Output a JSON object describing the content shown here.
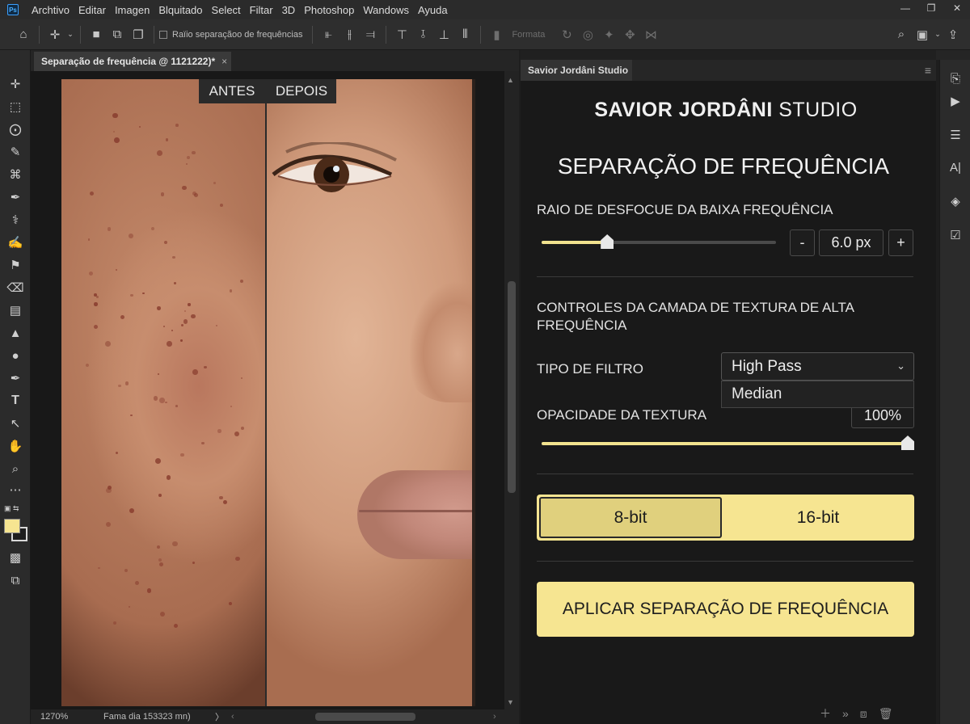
{
  "app": {
    "logo_text": "Ps",
    "menu": [
      "Archtivo",
      "Editar",
      "Imagen",
      "Blquitado",
      "Select",
      "Filtar",
      "3D",
      "Photoshop",
      "Wandows",
      "Ayuda"
    ]
  },
  "options_bar": {
    "checkbox_label": "Raïio separaçãoo de frequências",
    "format_label": "Formata"
  },
  "document": {
    "tab_title": "Separação de frequência @ 1121222)*",
    "close_glyph": "×",
    "before_label": "ANTES",
    "after_label": "DEPOIS"
  },
  "status": {
    "zoom": "1270%",
    "info": "Fama dia 153323 mn)",
    "arrow": "〉"
  },
  "panel": {
    "tab_title": "Savior Jordâni Studio",
    "brand_bold": "SAVIOR JORDÂNI",
    "brand_thin": "STUDIO",
    "title": "SEPARAÇÃO DE FREQUÊNCIA",
    "blur_label": "RAIO DE DESFOCUE DA BAIXA FREQUÊNCIA",
    "blur_value": "6.0 px",
    "blur_fraction": 0.28,
    "minus": "-",
    "plus": "+",
    "texture_heading": "CONTROLES DA CAMADA DE TEXTURA DE ALTA FREQUÊNCIA",
    "filter_label": "TIPO DE FILTRO",
    "filter_selected": "High Pass",
    "filter_option": "Median",
    "opacity_label": "OPACIDADE DA TEXTURA",
    "opacity_value": "100%",
    "opacity_fraction": 1.0,
    "bit_8": "8-bit",
    "bit_16": "16-bit",
    "bit_selected": "8-bit",
    "apply_label": "APLICAR SEPARAÇÃO DE FREQUÊNCIA"
  },
  "colors": {
    "accent": "#f6e591",
    "accent_selected": "#e0d07d",
    "panel_bg": "#191919"
  },
  "icons": {
    "toolbar": [
      "move-icon",
      "marquee-icon",
      "lasso-icon",
      "quick-select-icon",
      "crop-icon",
      "eyedropper-icon",
      "healing-icon",
      "brush-icon",
      "stamp-icon",
      "eraser-icon",
      "gradient-icon",
      "blur-icon",
      "dodge-icon",
      "pen-icon",
      "type-icon",
      "path-select-icon",
      "hand-icon",
      "zoom-icon",
      "more-icon"
    ],
    "dock": [
      "history-icon",
      "actions-icon",
      "adjustments-icon",
      "character-icon",
      "layers-icon",
      "properties-icon"
    ]
  }
}
